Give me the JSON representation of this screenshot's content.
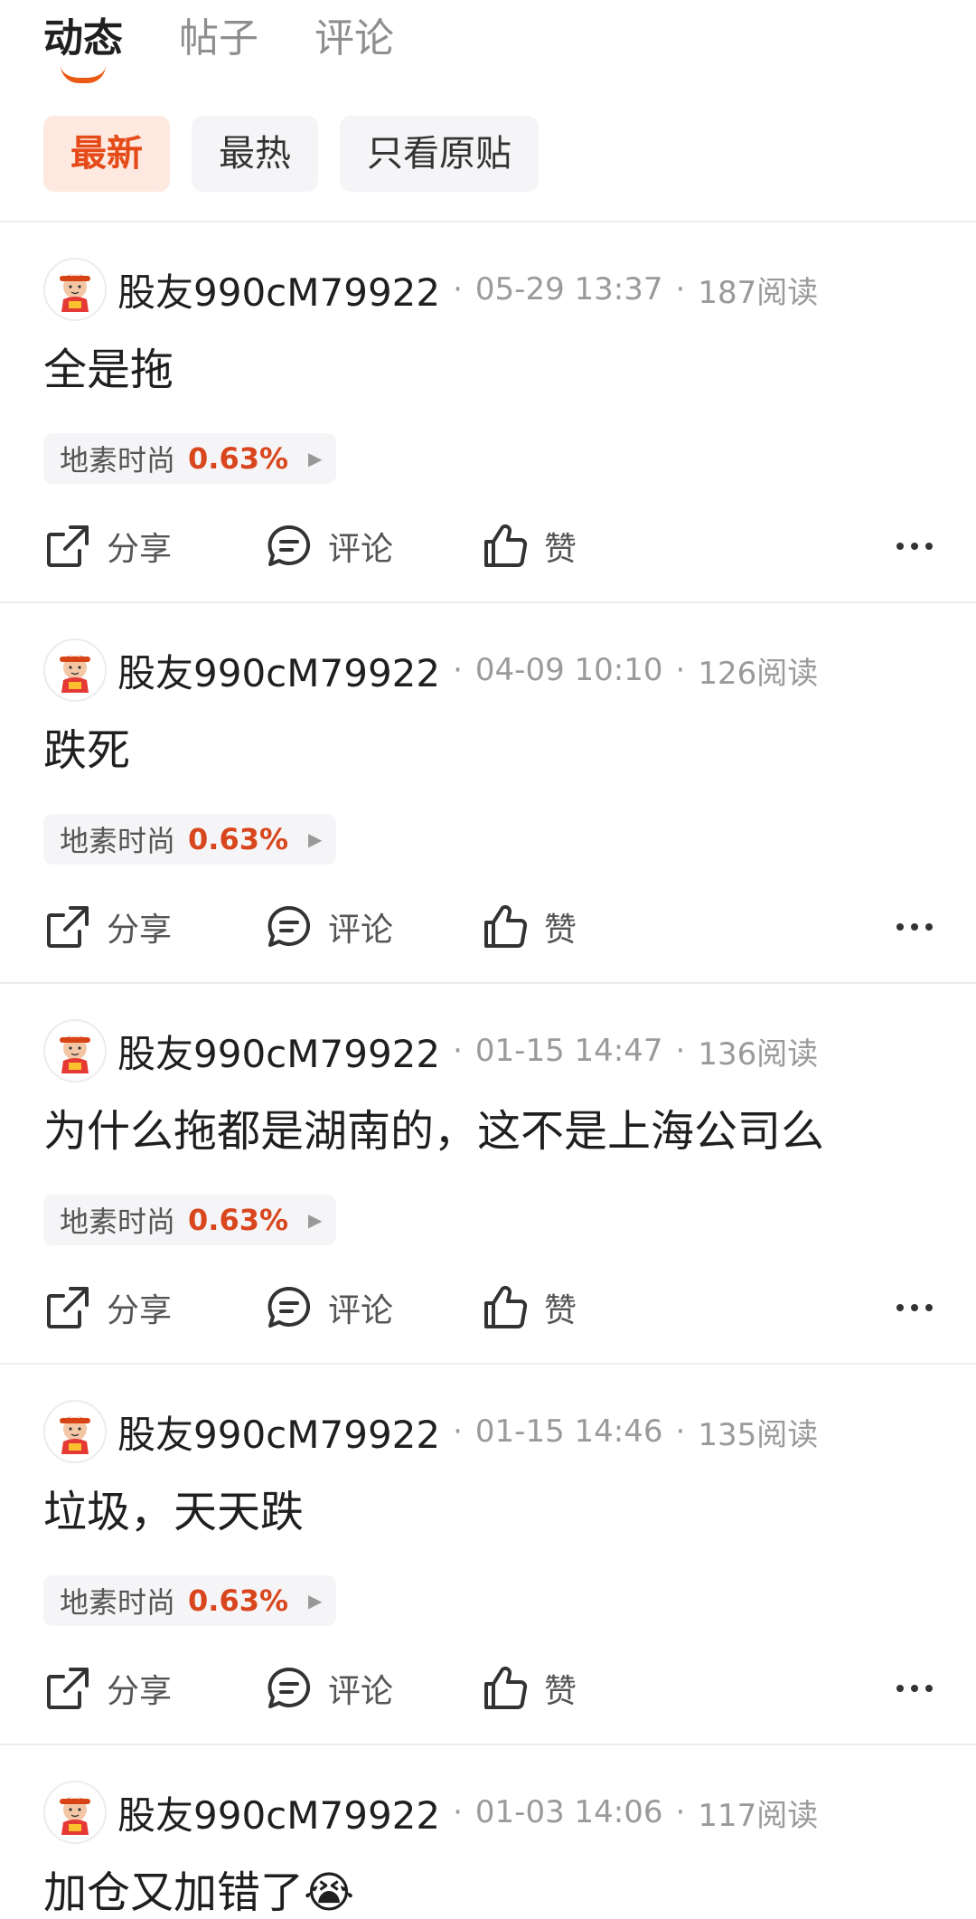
{
  "tabs": [
    {
      "label": "动态",
      "active": true
    },
    {
      "label": "帖子",
      "active": false
    },
    {
      "label": "评论",
      "active": false
    }
  ],
  "filters": [
    {
      "label": "最新",
      "active": true
    },
    {
      "label": "最热",
      "active": false
    },
    {
      "label": "只看原贴",
      "active": false
    }
  ],
  "colors": {
    "accent": "#ea5a14",
    "stock_up": "#d9461e"
  },
  "actions": {
    "share": "分享",
    "comment": "评论",
    "like": "赞"
  },
  "posts": [
    {
      "username": "股友990cM79922",
      "date": "05-29 13:37",
      "reads": "187阅读",
      "text": "全是拖",
      "stock": {
        "name": "地素时尚",
        "pct": "0.63%"
      }
    },
    {
      "username": "股友990cM79922",
      "date": "04-09 10:10",
      "reads": "126阅读",
      "text": "跌死",
      "stock": {
        "name": "地素时尚",
        "pct": "0.63%"
      }
    },
    {
      "username": "股友990cM79922",
      "date": "01-15 14:47",
      "reads": "136阅读",
      "text": "为什么拖都是湖南的，这不是上海公司么",
      "stock": {
        "name": "地素时尚",
        "pct": "0.63%"
      }
    },
    {
      "username": "股友990cM79922",
      "date": "01-15 14:46",
      "reads": "135阅读",
      "text": "垃圾，天天跌",
      "stock": {
        "name": "地素时尚",
        "pct": "0.63%"
      }
    },
    {
      "username": "股友990cM79922",
      "date": "01-03 14:06",
      "reads": "117阅读",
      "text": "加仓又加错了😭"
    }
  ]
}
